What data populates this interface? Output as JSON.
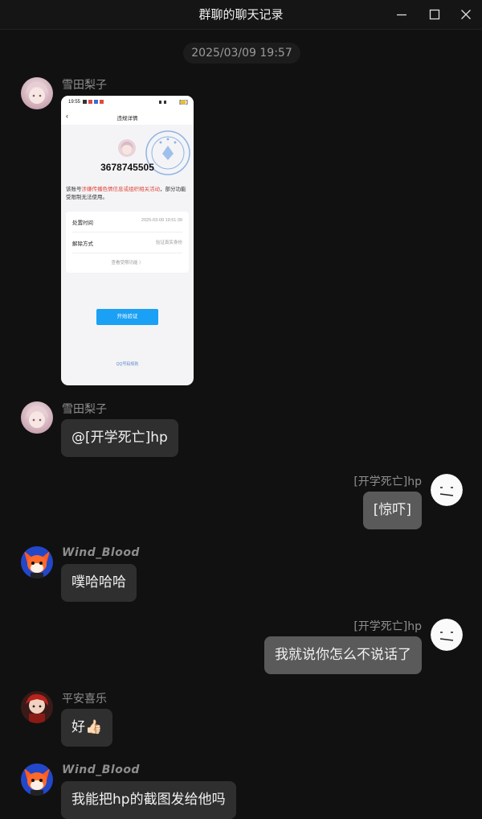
{
  "window": {
    "title": "群聊的聊天记录",
    "minimize_icon": "minimize-icon",
    "maximize_icon": "maximize-icon",
    "close_icon": "close-icon"
  },
  "timestamp": "2025/03/09 19:57",
  "messages": [
    {
      "sender": "雪田梨子",
      "type": "image",
      "screenshot": {
        "status_time": "19:55",
        "nav_title": "违规详情",
        "uid": "3678745505",
        "desc_prefix": "该账号",
        "desc_red": "涉嫌传播色情信息或组织相关活动",
        "desc_suffix": "，部分功能受限制无法使用。",
        "rows": [
          {
            "label": "处置时间",
            "value": "2025-03-09 19:51:39"
          },
          {
            "label": "解除方式",
            "value": "验证真实身份"
          }
        ],
        "more_link": "查看受限功能 〉",
        "button": "开始验证",
        "footer": "QQ号码规则"
      }
    },
    {
      "sender": "雪田梨子",
      "type": "text",
      "text": "@[开学死亡]hp"
    },
    {
      "sender": "[开学死亡]hp",
      "type": "text",
      "self": true,
      "text": "[惊吓]"
    },
    {
      "sender": "Wind_Blood",
      "type": "text",
      "text": "噗哈哈哈"
    },
    {
      "sender": "[开学死亡]hp",
      "type": "text",
      "self": true,
      "text": "我就说你怎么不说话了"
    },
    {
      "sender": "平安喜乐",
      "type": "text",
      "text": "好👍🏻"
    },
    {
      "sender": "Wind_Blood",
      "type": "text",
      "text": "我能把hp的截图发给他吗"
    }
  ]
}
